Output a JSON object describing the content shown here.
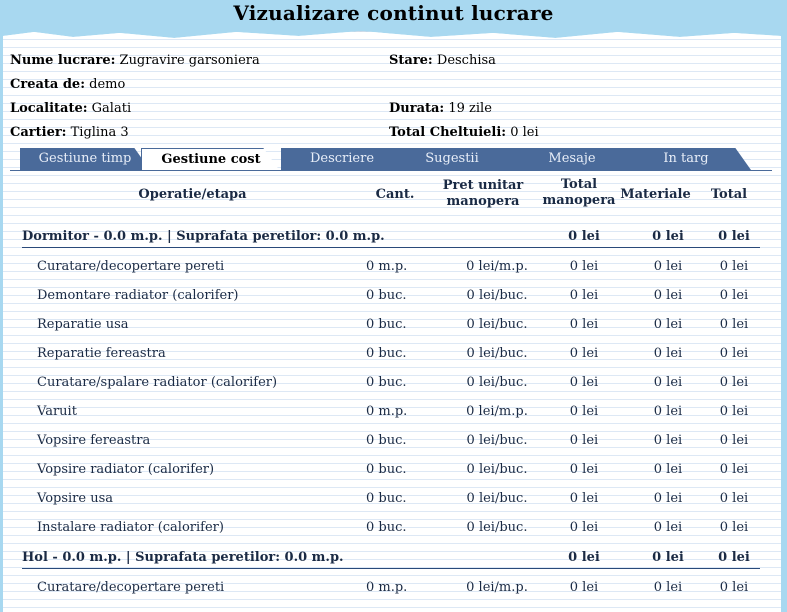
{
  "page": {
    "title": "Vizualizare continut lucrare"
  },
  "info": {
    "nume_label": "Nume lucrare:",
    "nume_value": "Zugravire garsoniera",
    "creata_label": "Creata de:",
    "creata_value": "demo",
    "localitate_label": "Localitate:",
    "localitate_value": "Galati",
    "cartier_label": "Cartier:",
    "cartier_value": "Tiglina 3",
    "stare_label": "Stare:",
    "stare_value": "Deschisa",
    "durata_label": "Durata:",
    "durata_value": "19 zile",
    "total_label": "Total Cheltuieli:",
    "total_value": "0 lei"
  },
  "tabs": [
    {
      "label": "Gestiune timp"
    },
    {
      "label": "Gestiune cost"
    },
    {
      "label": "Descriere"
    },
    {
      "label": "Sugestii"
    },
    {
      "label": "Mesaje"
    },
    {
      "label": "In targ"
    }
  ],
  "table": {
    "headers": {
      "operatie": "Operatie/etapa",
      "cant": "Cant.",
      "pret_l1": "Pret unitar",
      "pret_l2": "manopera",
      "total_man_l1": "Total",
      "total_man_l2": "manopera",
      "materiale": "Materiale",
      "total": "Total"
    },
    "groups": [
      {
        "label": "Dormitor - 0.0 m.p. | Suprafata peretilor: 0.0 m.p.",
        "total_manopera": "0 lei",
        "materiale": "0 lei",
        "total": "0 lei",
        "rows": [
          {
            "op": "Curatare/decopertare pereti",
            "cant": "0 m.p.",
            "pret": "0 lei/m.p.",
            "tman": "0 lei",
            "mat": "0 lei",
            "tot": "0 lei"
          },
          {
            "op": "Demontare radiator (calorifer)",
            "cant": "0 buc.",
            "pret": "0 lei/buc.",
            "tman": "0 lei",
            "mat": "0 lei",
            "tot": "0 lei"
          },
          {
            "op": "Reparatie usa",
            "cant": "0 buc.",
            "pret": "0 lei/buc.",
            "tman": "0 lei",
            "mat": "0 lei",
            "tot": "0 lei"
          },
          {
            "op": "Reparatie fereastra",
            "cant": "0 buc.",
            "pret": "0 lei/buc.",
            "tman": "0 lei",
            "mat": "0 lei",
            "tot": "0 lei"
          },
          {
            "op": "Curatare/spalare radiator (calorifer)",
            "cant": "0 buc.",
            "pret": "0 lei/buc.",
            "tman": "0 lei",
            "mat": "0 lei",
            "tot": "0 lei"
          },
          {
            "op": "Varuit",
            "cant": "0 m.p.",
            "pret": "0 lei/m.p.",
            "tman": "0 lei",
            "mat": "0 lei",
            "tot": "0 lei"
          },
          {
            "op": "Vopsire fereastra",
            "cant": "0 buc.",
            "pret": "0 lei/buc.",
            "tman": "0 lei",
            "mat": "0 lei",
            "tot": "0 lei"
          },
          {
            "op": "Vopsire radiator (calorifer)",
            "cant": "0 buc.",
            "pret": "0 lei/buc.",
            "tman": "0 lei",
            "mat": "0 lei",
            "tot": "0 lei"
          },
          {
            "op": "Vopsire usa",
            "cant": "0 buc.",
            "pret": "0 lei/buc.",
            "tman": "0 lei",
            "mat": "0 lei",
            "tot": "0 lei"
          },
          {
            "op": "Instalare radiator (calorifer)",
            "cant": "0 buc.",
            "pret": "0 lei/buc.",
            "tman": "0 lei",
            "mat": "0 lei",
            "tot": "0 lei"
          }
        ]
      },
      {
        "label": "Hol - 0.0 m.p. | Suprafata peretilor: 0.0 m.p.",
        "total_manopera": "0 lei",
        "materiale": "0 lei",
        "total": "0 lei",
        "rows": [
          {
            "op": "Curatare/decopertare pereti",
            "cant": "0 m.p.",
            "pret": "0 lei/m.p.",
            "tman": "0 lei",
            "mat": "0 lei",
            "tot": "0 lei"
          }
        ]
      }
    ]
  }
}
